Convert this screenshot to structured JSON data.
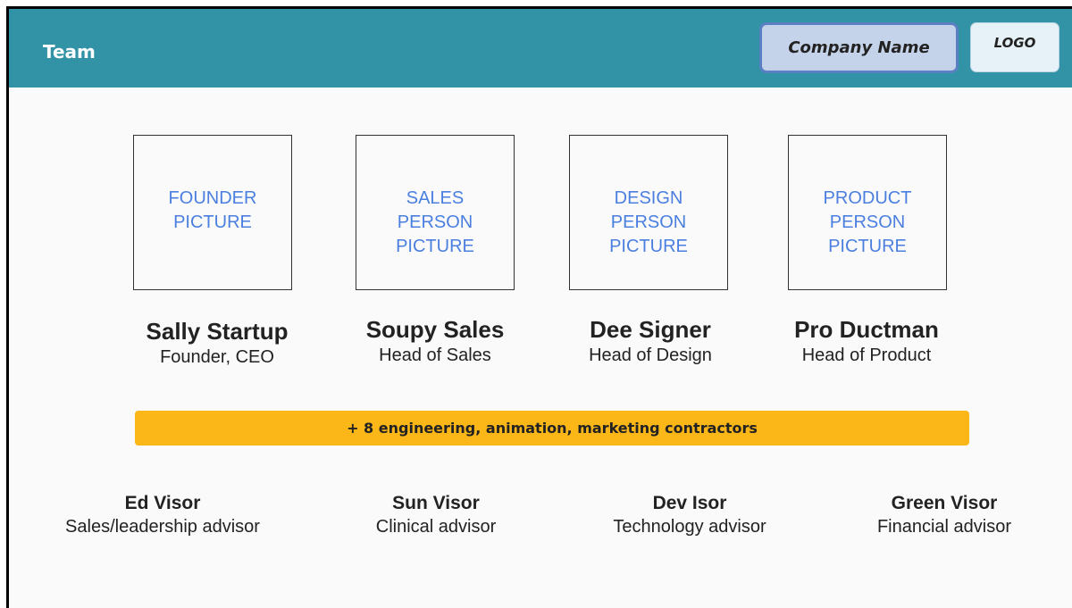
{
  "header": {
    "title": "Team",
    "company_name": "Company Name",
    "logo": "LOGO"
  },
  "team": [
    {
      "picture_label": "FOUNDER\nPICTURE",
      "name": "Sally Startup",
      "role": "Founder, CEO"
    },
    {
      "picture_label": "SALES\nPERSON\nPICTURE",
      "name": "Soupy Sales",
      "role": "Head of Sales"
    },
    {
      "picture_label": "DESIGN\nPERSON\nPICTURE",
      "name": "Dee Signer",
      "role": "Head of Design"
    },
    {
      "picture_label": "PRODUCT\nPERSON\nPICTURE",
      "name": "Pro Ductman",
      "role": "Head of Product"
    }
  ],
  "contractors_banner": "+ 8 engineering, animation, marketing contractors",
  "advisors": [
    {
      "name": "Ed Visor",
      "role": "Sales/leadership advisor"
    },
    {
      "name": "Sun Visor",
      "role": "Clinical advisor"
    },
    {
      "name": "Dev Isor",
      "role": "Technology advisor"
    },
    {
      "name": "Green Visor",
      "role": "Financial advisor"
    }
  ],
  "colors": {
    "header_bg": "#3393a6",
    "company_box_bg": "#c5d3ea",
    "company_box_border": "#5b7fc3",
    "logo_box_bg": "#e6f2f8",
    "picture_label": "#4a7fe0",
    "banner_bg": "#fbb618"
  }
}
